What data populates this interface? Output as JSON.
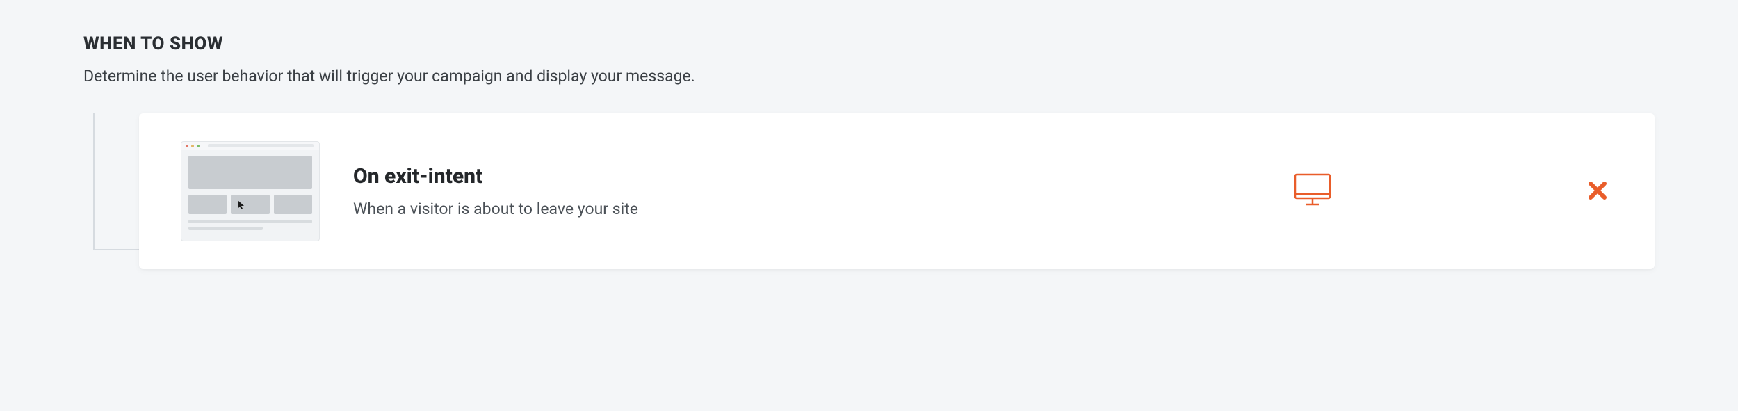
{
  "section": {
    "title": "WHEN TO SHOW",
    "description": "Determine the user behavior that will trigger your campaign and display your message."
  },
  "rule": {
    "title": "On exit-intent",
    "description": "When a visitor is about to leave your site"
  },
  "colors": {
    "accent": "#e95d2a"
  }
}
